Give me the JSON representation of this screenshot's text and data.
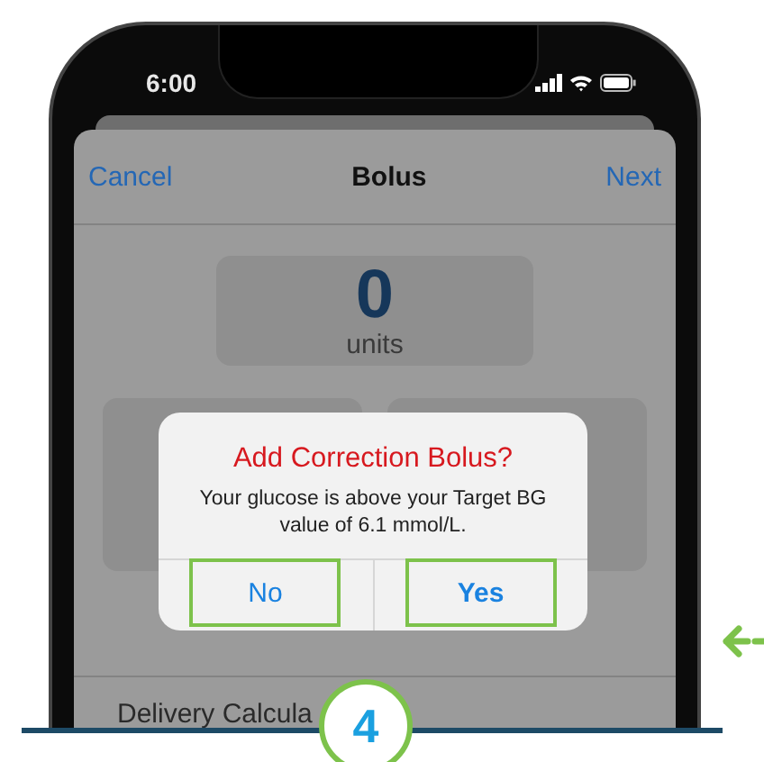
{
  "status_bar": {
    "time": "6:00"
  },
  "nav": {
    "cancel": "Cancel",
    "title": "Bolus",
    "next": "Next"
  },
  "amount": {
    "value": "0",
    "unit": "units"
  },
  "dialog": {
    "title": "Add Correction Bolus?",
    "message": "Your glucose is above your Target BG value of 6.1 mmol/L.",
    "buttons": [
      {
        "label": "No",
        "highlighted": true
      },
      {
        "label": "Yes",
        "highlighted": true
      }
    ]
  },
  "list_row": {
    "label": "Delivery Calcula"
  },
  "step_badge": "4"
}
